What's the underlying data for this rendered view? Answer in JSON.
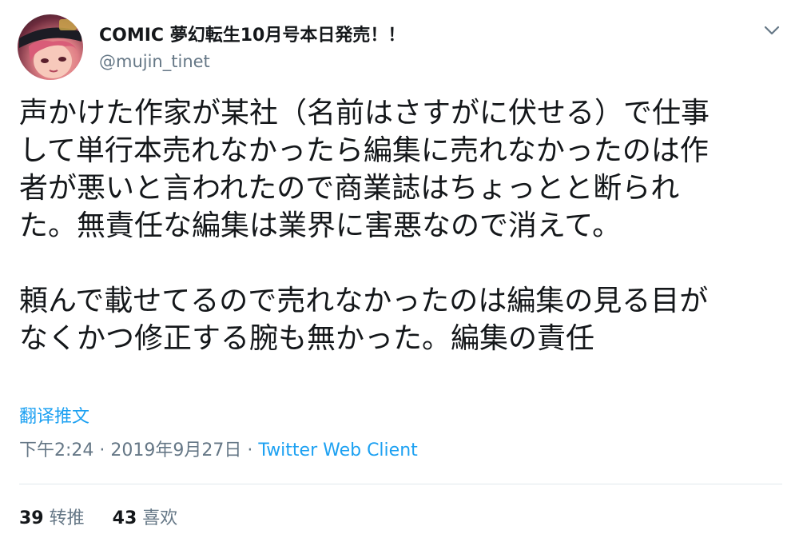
{
  "user": {
    "display_name": "COMIC 夢幻転生10月号本日発売！！",
    "handle": "@mujin_tinet",
    "avatar_icon": "user-avatar-illustration"
  },
  "menu": {
    "icon": "chevron-down-icon"
  },
  "tweet": {
    "lines": [
      "声かけた作家が某社（名前はさすがに伏せる）で仕事",
      "して単行本売れなかったら編集に売れなかったのは作",
      "者が悪いと言われたので商業誌はちょっとと断られ",
      "た。無責任な編集は業界に害悪なので消えて。",
      "",
      "頼んで載せてるので売れなかったのは編集の見る目が",
      "なくかつ修正する腕も無かった。編集の責任"
    ],
    "translate_label": "翻译推文",
    "time": "下午2:24",
    "separator": "·",
    "date": "2019年9月27日",
    "client": "Twitter Web Client"
  },
  "stats": {
    "retweets_count": "39",
    "retweets_label": "转推",
    "likes_count": "43",
    "likes_label": "喜欢"
  },
  "colors": {
    "link": "#1da1f2",
    "secondary_text": "#657786",
    "primary_text": "#14171a",
    "divider": "#e1e8ed"
  }
}
